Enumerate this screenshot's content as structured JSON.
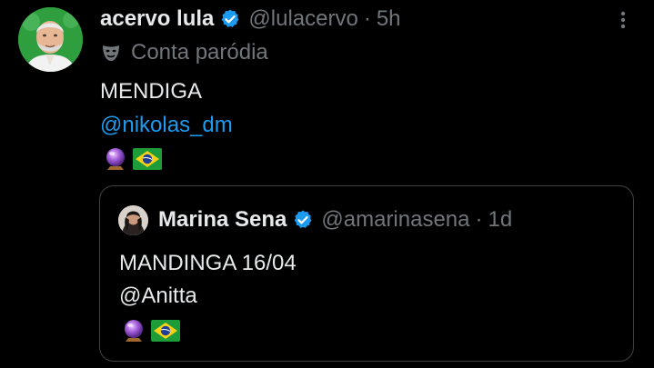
{
  "tweet": {
    "display_name": "acervo lula",
    "handle": "@lulacervo",
    "separator": "·",
    "time": "5h",
    "parody_label": "Conta paródia",
    "text_line1": "MENDIGA",
    "mention": "@nikolas_dm",
    "emojis": [
      "crystal-ball",
      "brazil-flag"
    ]
  },
  "quote": {
    "display_name": "Marina Sena",
    "handle": "@amarinasena",
    "separator": "·",
    "time": "1d",
    "text_line1": "MANDINGA 16/04",
    "text_line2": "@Anitta",
    "emojis": [
      "crystal-ball",
      "brazil-flag"
    ]
  },
  "colors": {
    "background": "#000000",
    "primary_text": "#e7e9ea",
    "secondary_text": "#71767b",
    "link": "#1d9bf0",
    "verified_badge": "#1d9bf0",
    "border": "#3e4144"
  }
}
